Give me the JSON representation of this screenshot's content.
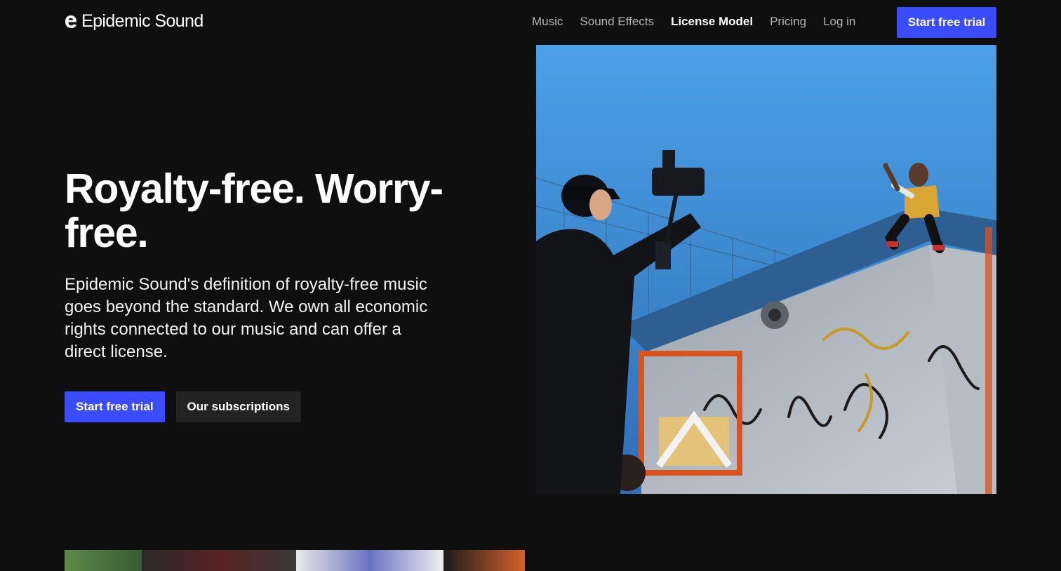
{
  "brand": {
    "name": "Epidemic Sound",
    "logo_icon": "epidemic-sound-logo-icon"
  },
  "nav": {
    "items": [
      {
        "label": "Music",
        "active": false
      },
      {
        "label": "Sound Effects",
        "active": false
      },
      {
        "label": "License Model",
        "active": true
      },
      {
        "label": "Pricing",
        "active": false
      },
      {
        "label": "Log in",
        "active": false
      }
    ],
    "cta_label": "Start free trial"
  },
  "hero": {
    "title": "Royalty-free. Worry-free.",
    "description": "Epidemic Sound's definition of royalty-free music goes beyond the standard. We own all economic rights connected to our music and can offer a direct license.",
    "primary_button": "Start free trial",
    "secondary_button": "Our subscriptions"
  },
  "colors": {
    "background": "#0f0f0f",
    "accent": "#3b4cff",
    "secondary_button": "#232323",
    "nav_inactive": "#b5b5b5"
  }
}
